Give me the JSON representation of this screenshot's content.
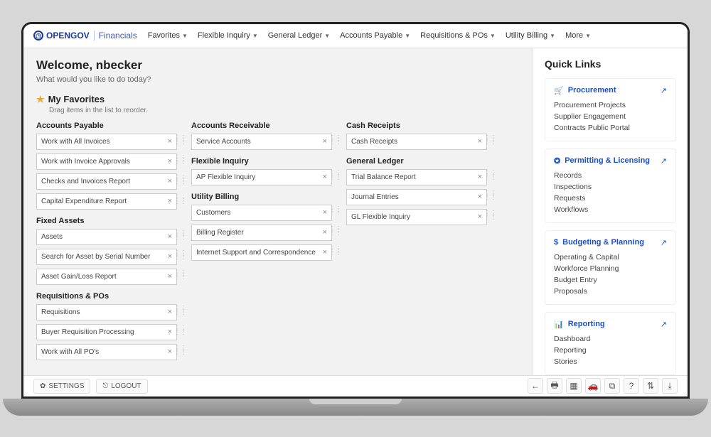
{
  "brand": {
    "name": "OPENGOV",
    "product": "Financials"
  },
  "nav": [
    "Favorites",
    "Flexible Inquiry",
    "General Ledger",
    "Accounts Payable",
    "Requisitions & POs",
    "Utility Billing",
    "More"
  ],
  "welcome": {
    "title": "Welcome, nbecker",
    "sub": "What would you like to do today?"
  },
  "fav": {
    "title": "My Favorites",
    "sub": "Drag items in the list to reorder."
  },
  "cols": [
    [
      {
        "h": "Accounts Payable",
        "items": [
          "Work with All Invoices",
          "Work with Invoice Approvals",
          "Checks and Invoices Report",
          "Capital Expenditure Report"
        ]
      },
      {
        "h": "Fixed Assets",
        "items": [
          "Assets",
          "Search for Asset by Serial Number",
          "Asset Gain/Loss Report"
        ]
      },
      {
        "h": "Requisitions & POs",
        "items": [
          "Requisitions",
          "Buyer Requisition Processing",
          "Work with All PO's"
        ]
      }
    ],
    [
      {
        "h": "Accounts Receivable",
        "items": [
          "Service Accounts"
        ]
      },
      {
        "h": "Flexible Inquiry",
        "items": [
          "AP Flexible Inquiry"
        ]
      },
      {
        "h": "Utility Billing",
        "items": [
          "Customers",
          "Billing Register",
          "Internet Support and Correspondence"
        ]
      }
    ],
    [
      {
        "h": "Cash Receipts",
        "items": [
          "Cash Receipts"
        ]
      },
      {
        "h": "General Ledger",
        "items": [
          "Trial Balance Report",
          "Journal Entries",
          "GL Flexible Inquiry"
        ]
      }
    ]
  ],
  "quick": {
    "title": "Quick Links",
    "cards": [
      {
        "icon": "🛒",
        "title": "Procurement",
        "links": [
          "Procurement Projects",
          "Supplier Engagement",
          "Contracts Public Portal"
        ]
      },
      {
        "icon": "✪",
        "title": "Permitting & Licensing",
        "links": [
          "Records",
          "Inspections",
          "Requests",
          "Workflows"
        ]
      },
      {
        "icon": "$",
        "title": "Budgeting & Planning",
        "links": [
          "Operating & Capital",
          "Workforce Planning",
          "Budget Entry",
          "Proposals"
        ]
      },
      {
        "icon": "📊",
        "title": "Reporting",
        "links": [
          "Dashboard",
          "Reporting",
          "Stories"
        ]
      }
    ]
  },
  "footer": {
    "settings": "SETTINGS",
    "logout": "LOGOUT",
    "icons": [
      "←",
      "🖶",
      "▦",
      "🚗",
      "⧉",
      "?",
      "⇅",
      "⤓"
    ]
  }
}
